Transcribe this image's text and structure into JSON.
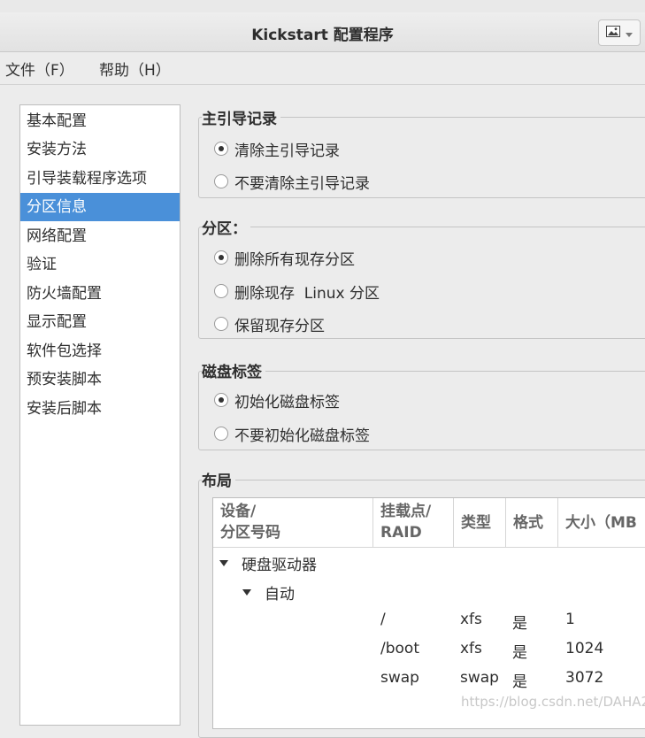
{
  "window": {
    "title": "Kickstart 配置程序"
  },
  "menubar": {
    "file": "文件（F）",
    "help": "帮助（H）"
  },
  "sidebar": {
    "items": [
      "基本配置",
      "安装方法",
      "引导装载程序选项",
      "分区信息",
      "网络配置",
      "验证",
      "防火墙配置",
      "显示配置",
      "软件包选择",
      "预安装脚本",
      "安装后脚本"
    ],
    "selected": "分区信息"
  },
  "mbr": {
    "title": "主引导记录",
    "options": [
      "清除主引导记录",
      "不要清除主引导记录"
    ],
    "selected": "清除主引导记录"
  },
  "partition": {
    "title": "分区：",
    "options": [
      "删除所有现存分区",
      "删除现存  Linux 分区",
      "保留现存分区"
    ],
    "selected": "删除所有现存分区"
  },
  "disklabel": {
    "title": "磁盘标签",
    "options": [
      "初始化磁盘标签",
      "不要初始化磁盘标签"
    ],
    "selected": "初始化磁盘标签"
  },
  "layout": {
    "title": "布局",
    "headers": {
      "device_l1": "设备/",
      "device_l2": "分区号码",
      "mount_l1": "挂载点/",
      "mount_l2": "RAID",
      "type": "类型",
      "format": "格式",
      "size": "大小（MB"
    },
    "tree": {
      "root": "硬盘驱动器",
      "child": "自动"
    },
    "rows": [
      {
        "mount": "/",
        "type": "xfs",
        "format": "是",
        "size": "1"
      },
      {
        "mount": "/boot",
        "type": "xfs",
        "format": "是",
        "size": "1024"
      },
      {
        "mount": "swap",
        "type": "swap",
        "format": "是",
        "size": "3072"
      }
    ]
  },
  "watermark": "https://blog.csdn.net/DAHA2"
}
